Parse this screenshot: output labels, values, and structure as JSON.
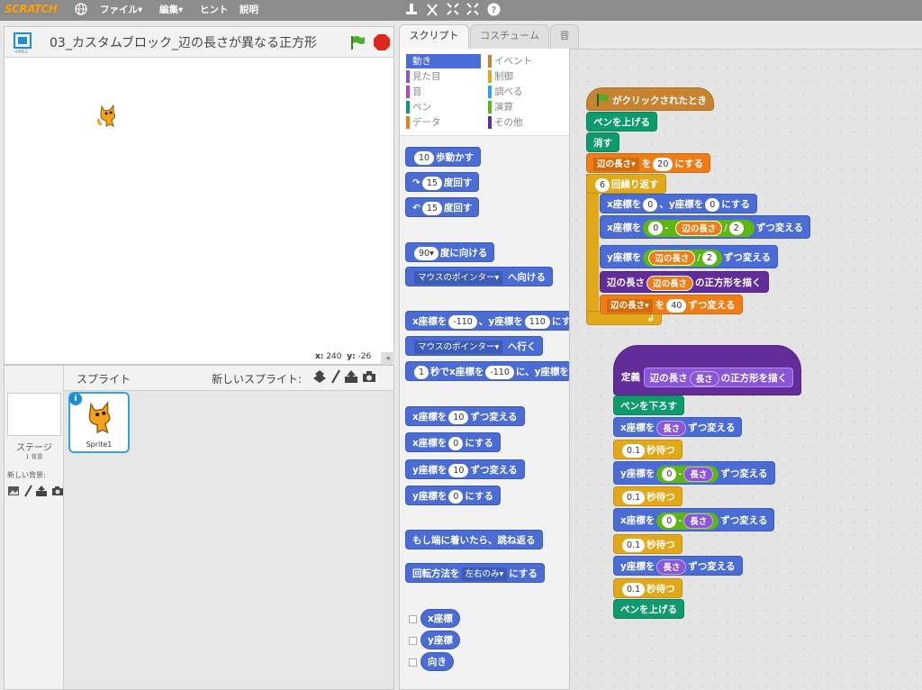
{
  "menubar": {
    "logo": "SCRATCH",
    "file": "ファイル▾",
    "edit": "編集▾",
    "tips": "ヒント",
    "about": "説明"
  },
  "stage": {
    "title": "03_カスタムブロック_辺の長さが異なる正方形",
    "version": "v461",
    "x_label": "x:",
    "x_value": "240",
    "y_label": "y:",
    "y_value": "-26"
  },
  "sprites": {
    "header": "スプライト",
    "new_sprite": "新しいスプライト:",
    "stage_label": "ステージ",
    "backdrop_count": "1 背景",
    "new_backdrop": "新しい背景:",
    "sprite1": "Sprite1"
  },
  "tabs": [
    "スクリプト",
    "コスチューム",
    "音"
  ],
  "categories": {
    "motion": "動き",
    "looks": "見た目",
    "sound": "音",
    "pen": "ペン",
    "data": "データ",
    "events": "イベント",
    "control": "制御",
    "sensing": "調べる",
    "operators": "演算",
    "more": "その他"
  },
  "palette": {
    "move_pre": "10",
    "move_post": "歩動かす",
    "turn_cw_val": "15",
    "turn_cw": "度回す",
    "turn_ccw_val": "15",
    "turn_ccw": "度回す",
    "point_val": "90▾",
    "point_post": "度に向ける",
    "point_towards_dd": "マウスのポインター▾",
    "point_towards_post": "へ向ける",
    "goto_pre": "x座標を",
    "goto_x": "-110",
    "goto_mid": "、y座標を",
    "goto_y": "110",
    "goto_post": "にす",
    "goto_to_dd": "マウスのポインター▾",
    "goto_to_post": "へ行く",
    "glide_val": "1",
    "glide_mid": "秒でx座標を",
    "glide_x": "-110",
    "glide_post": "に、y座標を",
    "changex_pre": "x座標を",
    "changex_val": "10",
    "changex_post": "ずつ変える",
    "setx_pre": "x座標を",
    "setx_val": "0",
    "setx_post": "にする",
    "changey_pre": "y座標を",
    "changey_val": "10",
    "changey_post": "ずつ変える",
    "sety_pre": "y座標を",
    "sety_val": "0",
    "sety_post": "にする",
    "bounce": "もし端に着いたら、跳ね返る",
    "rotstyle_pre": "回転方法を",
    "rotstyle_dd": "左右のみ▾",
    "rotstyle_post": "にする",
    "rep_x": "x座標",
    "rep_y": "y座標",
    "rep_dir": "向き"
  },
  "script1": {
    "hat": "がクリックされたとき",
    "penup1": "ペンを上げる",
    "clear": "消す",
    "setvar_dd": "辺の長さ▾",
    "setvar_mid": "を",
    "setvar_val": "20",
    "setvar_post": "にする",
    "repeat_val": "6",
    "repeat_post": "回繰り返す",
    "s1_pre": "x座標を",
    "s1_x": "0",
    "s1_mid": "、y座標を",
    "s1_y": "0",
    "s1_post": "にする",
    "s2_pre": "x座標を",
    "s2_a": "0",
    "s2_minus": "-",
    "s2_var": "辺の長さ",
    "s2_div": "/",
    "s2_b": "2",
    "s2_post": "ずつ変える",
    "s3_pre": "y座標を",
    "s3_var": "辺の長さ",
    "s3_div": "/",
    "s3_b": "2",
    "s3_post": "ずつ変える",
    "s4_pre": "辺の長さ",
    "s4_var": "辺の長さ",
    "s4_post": "の正方形を描く",
    "s5_dd": "辺の長さ▾",
    "s5_mid": "を",
    "s5_val": "40",
    "s5_post": "ずつ変える",
    "loop_arrow": "↲"
  },
  "script2": {
    "define": "定義",
    "def_a": "辺の長さ",
    "def_param": "長さ",
    "def_b": "の正方形を描く",
    "pendown": "ペンを下ろす",
    "c1_pre": "x座標を",
    "c1_param": "長さ",
    "c1_post": "ずつ変える",
    "w1_val": "0.1",
    "w1_post": "秒待つ",
    "c2_pre": "y座標を",
    "c2_a": "0",
    "c2_minus": "-",
    "c2_param": "長さ",
    "c2_post": "ずつ変える",
    "w2_val": "0.1",
    "w2_post": "秒待つ",
    "c3_pre": "x座標を",
    "c3_a": "0",
    "c3_minus": "-",
    "c3_param": "長さ",
    "c3_post": "ずつ変える",
    "w3_val": "0.1",
    "w3_post": "秒待つ",
    "c4_pre": "y座標を",
    "c4_param": "長さ",
    "c4_post": "ずつ変える",
    "w4_val": "0.1",
    "w4_post": "秒待つ",
    "penup": "ペンを上げる"
  }
}
